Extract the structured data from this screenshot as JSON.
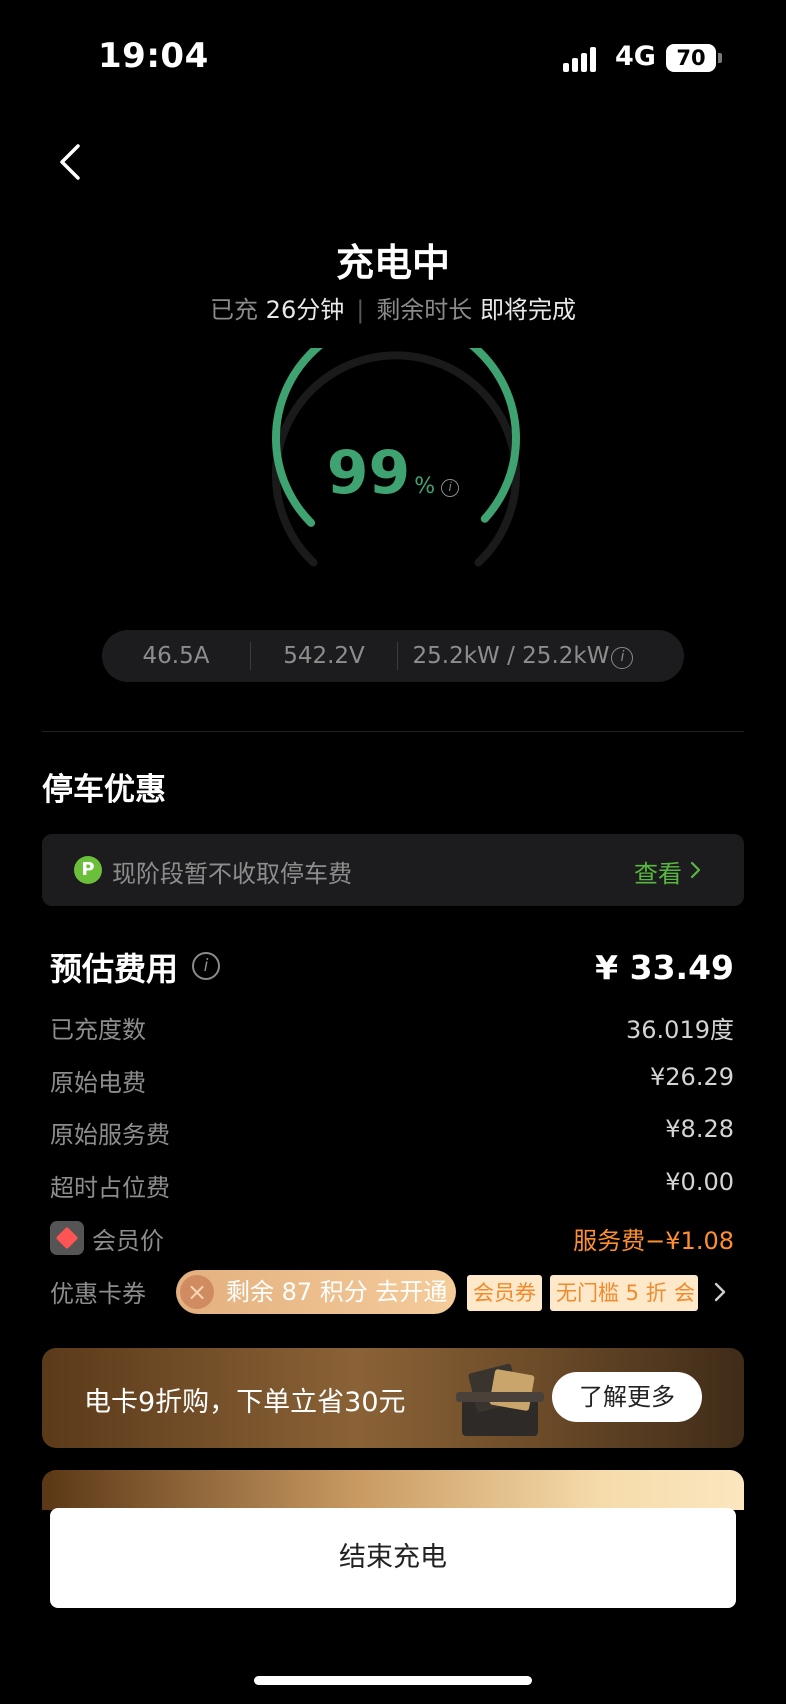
{
  "status_bar": {
    "time": "19:04",
    "network": "4G",
    "battery": "70"
  },
  "header": {
    "title": "充电中",
    "charged_label": "已充",
    "charged_value": "26分钟",
    "separator": "|",
    "remaining_label": "剩余时长",
    "remaining_value": "即将完成"
  },
  "gauge": {
    "percent": "99",
    "unit": "%",
    "level": 0.99,
    "color": "#3fa271"
  },
  "stats": {
    "current": "46.5A",
    "voltage": "542.2V",
    "power": "25.2kW / 25.2kW"
  },
  "parking": {
    "title": "停车优惠",
    "badge": "P",
    "text": "现阶段暂不收取停车费",
    "link": "查看"
  },
  "fees": {
    "title": "预估费用",
    "total": "¥ 33.49",
    "rows": [
      {
        "label": "已充度数",
        "value": "36.019度"
      },
      {
        "label": "原始电费",
        "value": "¥26.29"
      },
      {
        "label": "原始服务费",
        "value": "¥8.28"
      },
      {
        "label": "超时占位费",
        "value": "¥0.00"
      }
    ],
    "member": {
      "label": "会员价",
      "value": "服务费−¥1.08"
    }
  },
  "coupons": {
    "label": "优惠卡券",
    "points_pill": "剩余 87 积分 去开通",
    "tags": [
      "会员券",
      "无门槛 5 折",
      "会"
    ]
  },
  "promo": {
    "text": "电卡9折购，下单立省30元",
    "button": "了解更多"
  },
  "end_button": "结束充电",
  "colors": {
    "accent_green": "#3fa271",
    "link_green": "#58b840",
    "orange": "#ff8f2e",
    "background": "#000000"
  }
}
